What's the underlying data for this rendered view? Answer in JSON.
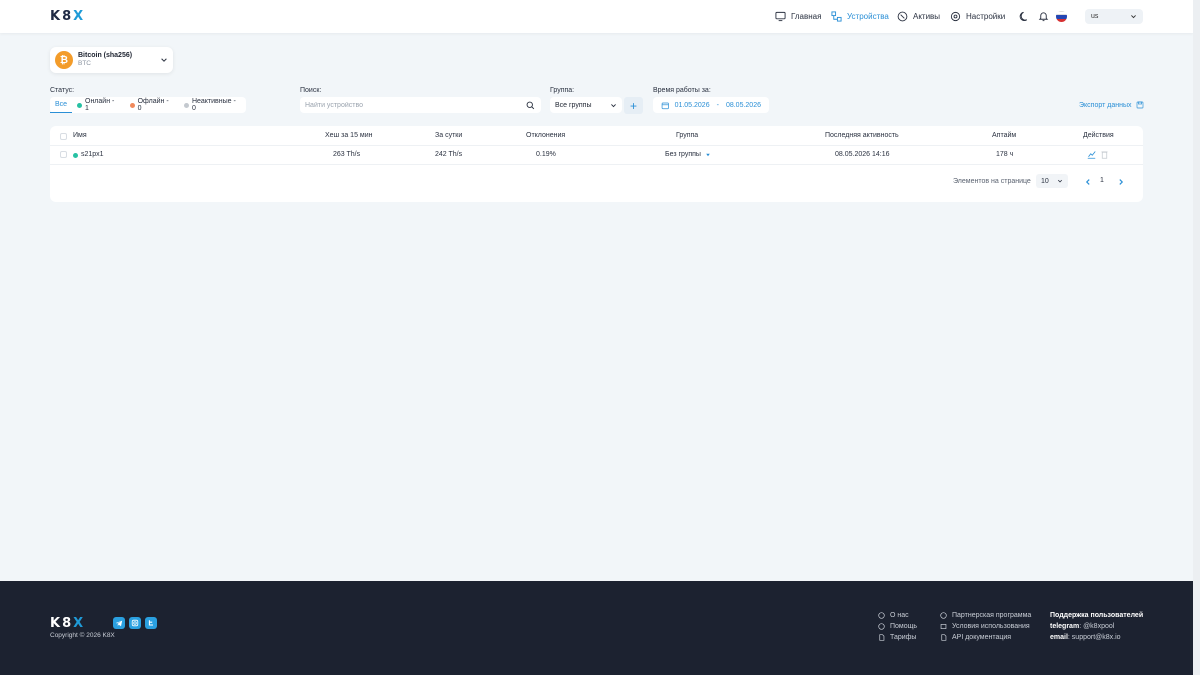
{
  "header": {
    "logo_left": "K8",
    "logo_x": "X",
    "nav": [
      {
        "label": "Главная",
        "icon": "monitor-icon"
      },
      {
        "label": "Устройства",
        "icon": "devices-icon"
      },
      {
        "label": "Активы",
        "icon": "coin-icon"
      },
      {
        "label": "Настройки",
        "icon": "gear-icon"
      }
    ],
    "active_nav": "Устройства",
    "language_value": "us"
  },
  "coin": {
    "name": "Bitcoin (sha256)",
    "symbol": "BTC",
    "glyph": "₿"
  },
  "filters": {
    "status_label": "Статус:",
    "status_tabs": [
      {
        "label": "Все"
      },
      {
        "label": "Онлайн - 1",
        "color": "#27c1a3"
      },
      {
        "label": "Офлайн - 0",
        "color": "#f08a5d"
      },
      {
        "label": "Неактивные - 0",
        "color": "#c4c9cf"
      }
    ],
    "search_label": "Поиск:",
    "search_placeholder": "Найти устройство",
    "group_label": "Группа:",
    "group_value": "Все группы",
    "time_label": "Время работы за:",
    "date_from": "01.05.2026",
    "date_sep": "-",
    "date_to": "08.05.2026",
    "export_label": "Экспорт данных"
  },
  "table": {
    "headers": {
      "name": "Имя",
      "hash15": "Хеш за 15 мин",
      "day": "За сутки",
      "reject": "Отклонения",
      "group": "Группа",
      "last": "Последняя активность",
      "uptime": "Аптайм",
      "actions": "Действия"
    },
    "rows": [
      {
        "name": "s21px1",
        "status_color": "#27c1a3",
        "hash15": "263 Th/s",
        "day": "242 Th/s",
        "reject": "0.19%",
        "group": "Без группы",
        "last": "08.05.2026 14:16",
        "uptime": "178 ч"
      }
    ]
  },
  "pagination": {
    "per_page_label": "Элементов на странице",
    "per_page_value": "10",
    "current_page": "1"
  },
  "footer": {
    "copyright": "Copyright © 2026 K8X",
    "links_col1": [
      "О нас",
      "Помощь",
      "Тарифы"
    ],
    "links_col2": [
      "Партнерская программа",
      "Условия использования",
      "API документация"
    ],
    "support_title": "Поддержка пользователей",
    "telegram_label": "telegram",
    "telegram_value": ": @k8xpool",
    "email_label": "email",
    "email_value": ": support@k8x.io"
  },
  "colors": {
    "accent": "#2a8fd6",
    "online": "#27c1a3",
    "offline": "#f08a5d",
    "inactive": "#c4c9cf",
    "footer_bg": "#1c2230"
  }
}
